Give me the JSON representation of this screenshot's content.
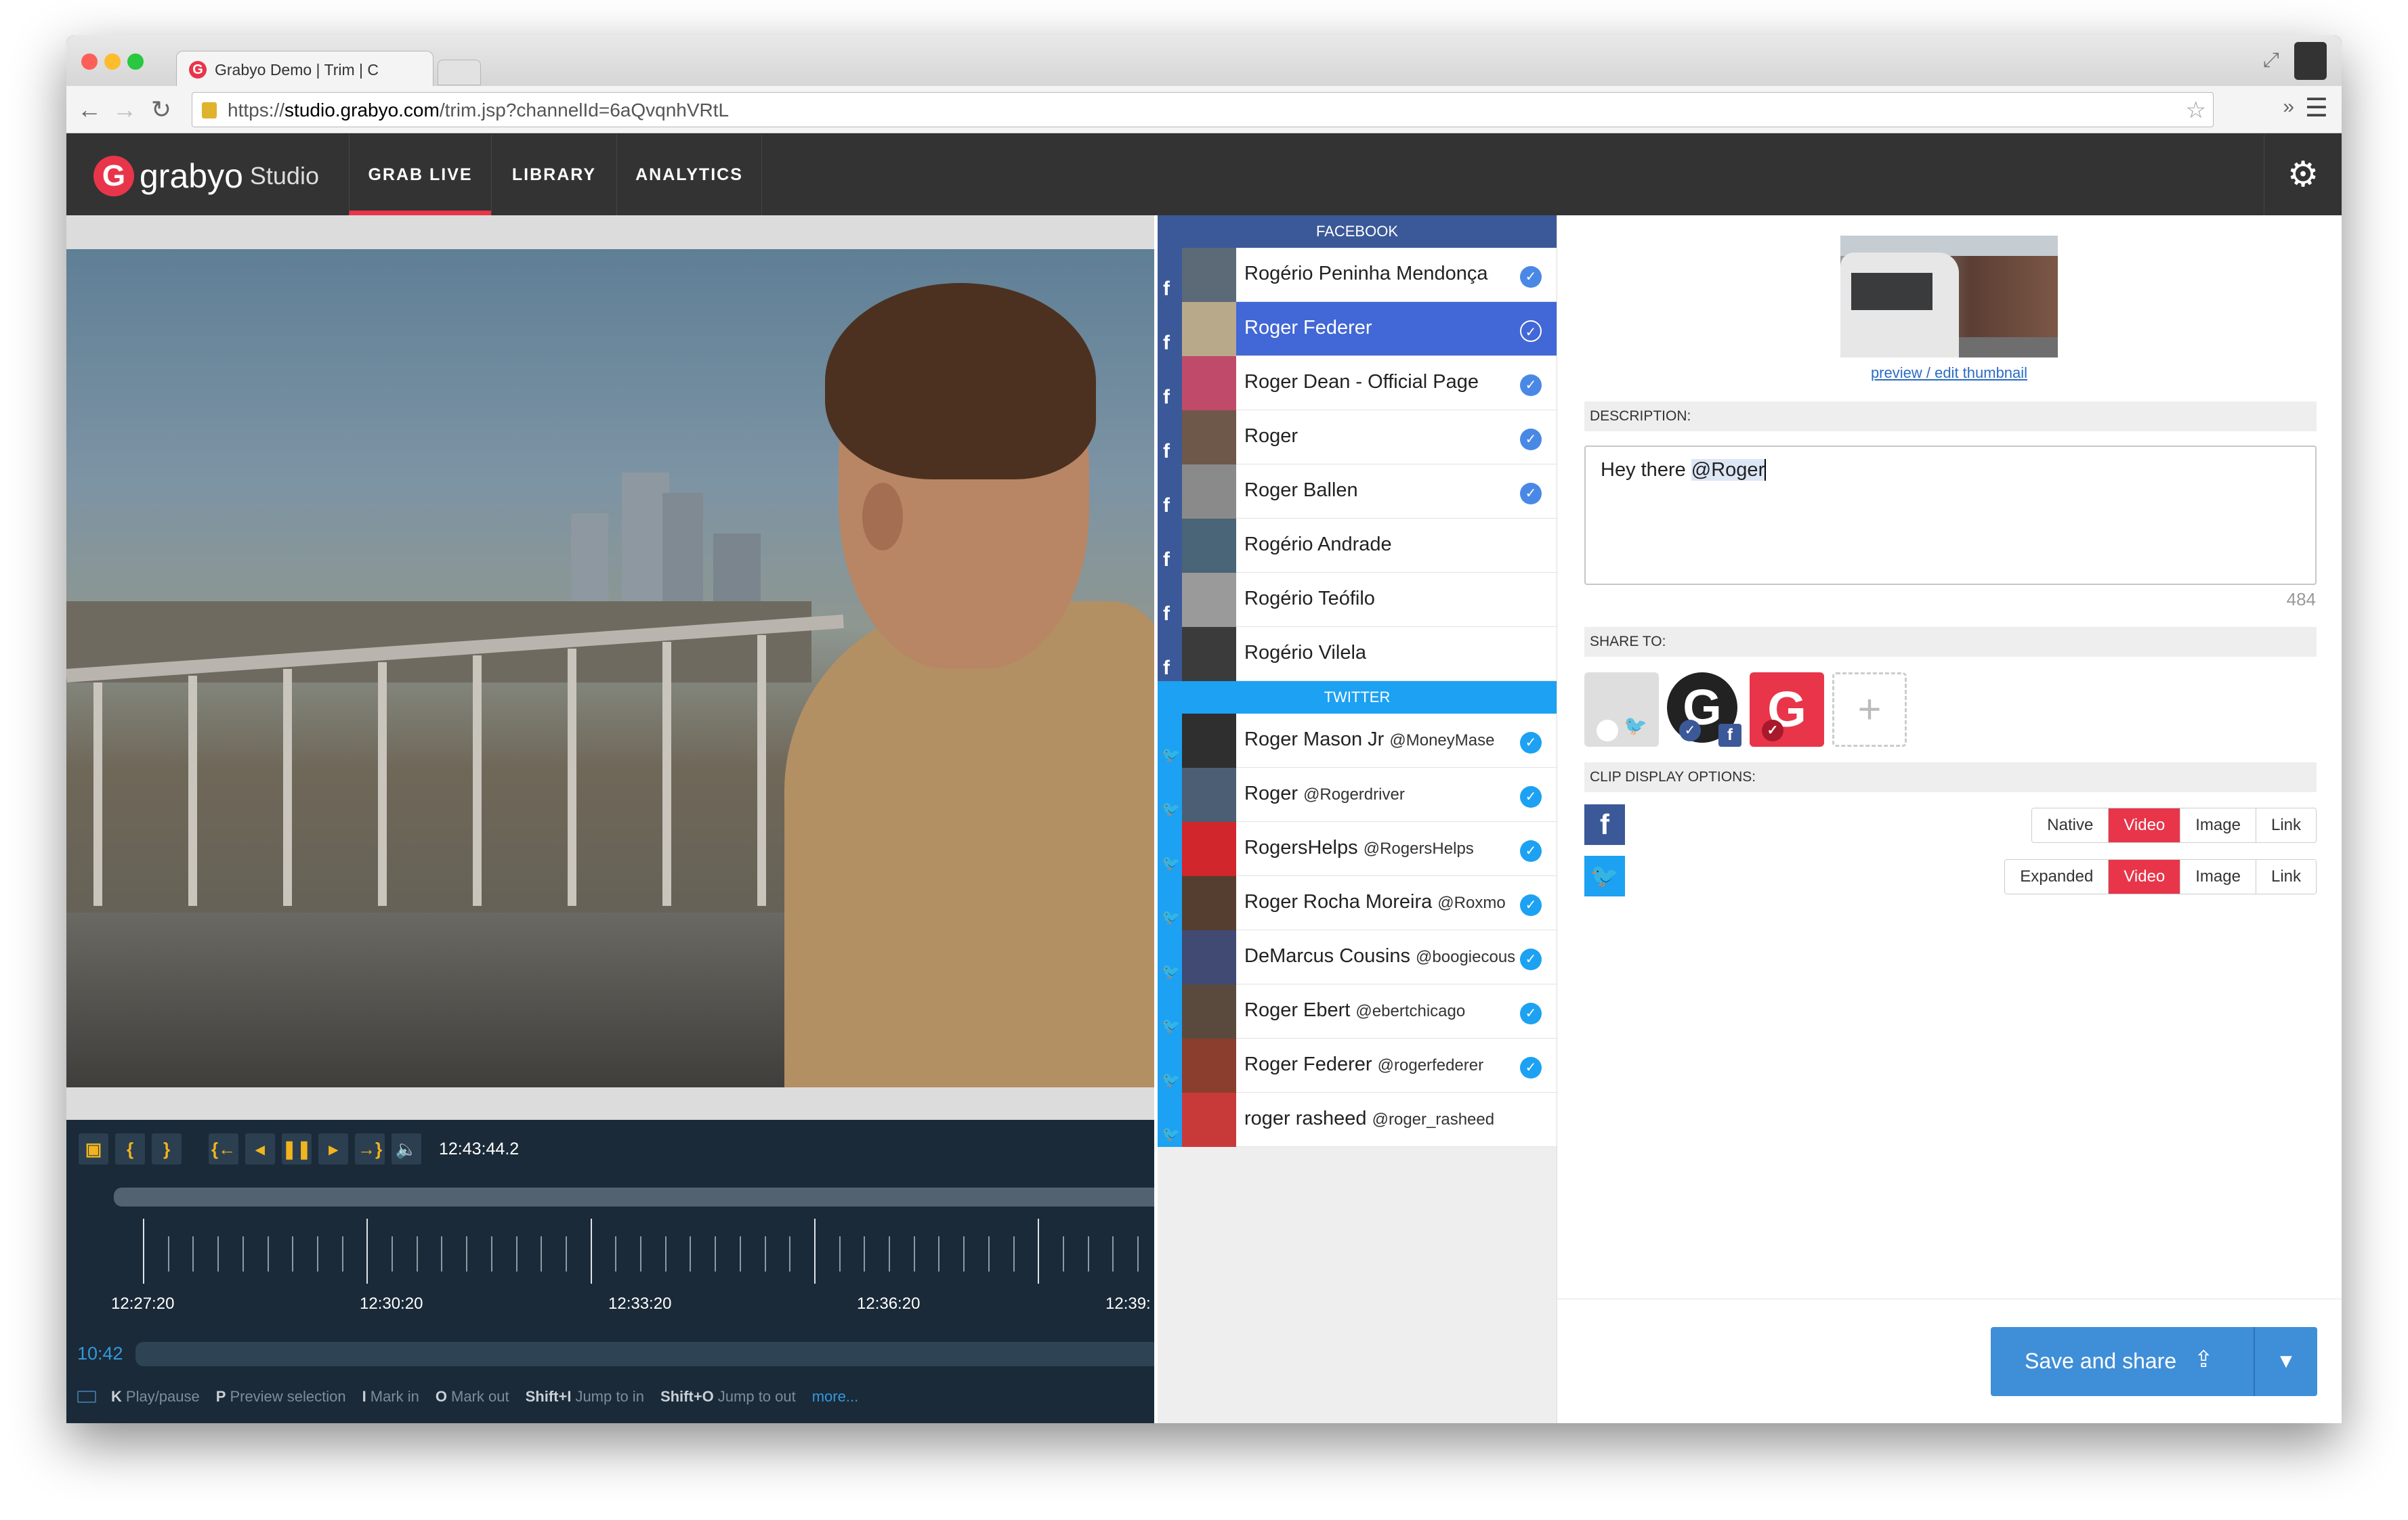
{
  "browser": {
    "tab_title": "Grabyo Demo | Trim | C",
    "url_prefix": "https://",
    "url_host": "studio.grabyo.com",
    "url_path": "/trim.jsp?channelId=6aQvqnhVRtL"
  },
  "nav": {
    "logo_word": "grabyo",
    "logo_sub": "Studio",
    "tabs": [
      "GRAB LIVE",
      "LIBRARY",
      "ANALYTICS"
    ],
    "active_tab": "GRAB LIVE"
  },
  "player": {
    "timecode": "12:43:44.2",
    "timeline_labels": [
      "12:27:20",
      "12:30:20",
      "12:33:20",
      "12:36:20",
      "12:39:"
    ],
    "start_time": "10:42",
    "shortcuts": [
      {
        "key": "K",
        "label": "Play/pause"
      },
      {
        "key": "P",
        "label": "Preview selection"
      },
      {
        "key": "I",
        "label": "Mark in"
      },
      {
        "key": "O",
        "label": "Mark out"
      },
      {
        "key": "Shift+I",
        "label": "Jump to in"
      },
      {
        "key": "Shift+O",
        "label": "Jump to out"
      }
    ],
    "more_link": "more..."
  },
  "mentions": {
    "facebook_header": "FACEBOOK",
    "twitter_header": "TWITTER",
    "facebook": [
      {
        "name": "Rogério Peninha Mendonça",
        "verified": true
      },
      {
        "name": "Roger Federer",
        "verified": true,
        "selected": true
      },
      {
        "name": "Roger Dean - Official Page",
        "verified": true
      },
      {
        "name": "Roger",
        "verified": true
      },
      {
        "name": "Roger Ballen",
        "verified": true
      },
      {
        "name": "Rogério Andrade",
        "verified": false
      },
      {
        "name": "Rogério Teófilo",
        "verified": false
      },
      {
        "name": "Rogério Vilela",
        "verified": false
      }
    ],
    "twitter": [
      {
        "name": "Roger Mason Jr",
        "handle": "@MoneyMase",
        "verified": true
      },
      {
        "name": "Roger",
        "handle": "@Rogerdriver",
        "verified": true
      },
      {
        "name": "RogersHelps",
        "handle": "@RogersHelps",
        "verified": true
      },
      {
        "name": "Roger Rocha Moreira",
        "handle": "@Roxmo",
        "verified": true
      },
      {
        "name": "DeMarcus Cousins",
        "handle": "@boogiecous",
        "verified": true
      },
      {
        "name": "Roger Ebert",
        "handle": "@ebertchicago",
        "verified": true
      },
      {
        "name": "Roger Federer",
        "handle": "@rogerfederer",
        "verified": true
      },
      {
        "name": "roger rasheed",
        "handle": "@roger_rasheed",
        "verified": false
      }
    ]
  },
  "details": {
    "thumb_link": "preview / edit thumbnail",
    "description_label": "DESCRIPTION:",
    "description_text": "Hey there ",
    "description_mention": "@Roger",
    "char_count": "484",
    "share_label": "SHARE TO:",
    "clip_label": "CLIP DISPLAY OPTIONS:",
    "facebook_options": [
      "Native",
      "Video",
      "Image",
      "Link"
    ],
    "facebook_selected": "Video",
    "twitter_options": [
      "Expanded",
      "Video",
      "Image",
      "Link"
    ],
    "twitter_selected": "Video",
    "save_label": "Save and share"
  },
  "colors": {
    "brand_red": "#e8354a",
    "facebook_blue": "#3b5998",
    "twitter_blue": "#1da1f2",
    "selected_row": "#4267d6",
    "save_button": "#3f8ed8"
  }
}
